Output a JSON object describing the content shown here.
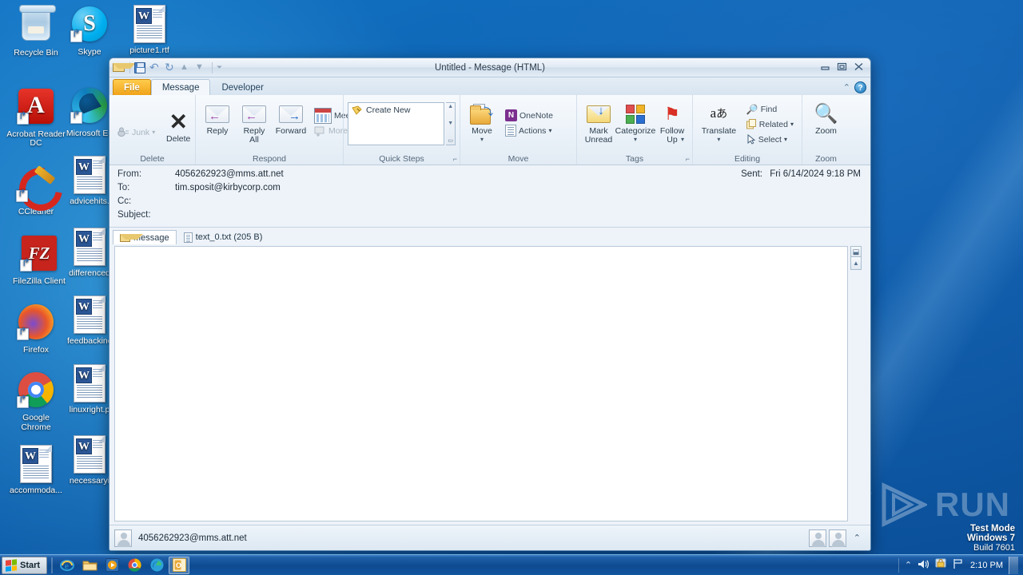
{
  "desktop": {
    "icons_col1": [
      {
        "name": "Recycle Bin",
        "kind": "recycle-bin"
      },
      {
        "name": "Acrobat Reader DC",
        "kind": "acrobat"
      },
      {
        "name": "CCleaner",
        "kind": "ccleaner"
      },
      {
        "name": "FileZilla Client",
        "kind": "filezilla"
      },
      {
        "name": "Firefox",
        "kind": "firefox"
      },
      {
        "name": "Google Chrome",
        "kind": "chrome"
      },
      {
        "name": "accommoda...",
        "kind": "word-doc"
      }
    ],
    "icons_col2": [
      {
        "name": "Skype",
        "kind": "skype"
      },
      {
        "name": "Microsoft Ed",
        "kind": "edge"
      },
      {
        "name": "advicehits.",
        "kind": "word-doc"
      },
      {
        "name": "differenced",
        "kind": "word-doc"
      },
      {
        "name": "feedbackinc",
        "kind": "word-doc"
      },
      {
        "name": "linuxright.p",
        "kind": "word-doc"
      },
      {
        "name": "necessaryi",
        "kind": "word-doc"
      }
    ],
    "icons_col3": [
      {
        "name": "picture1.rtf",
        "kind": "word-doc"
      }
    ]
  },
  "window": {
    "title": "Untitled  -  Message (HTML)",
    "quick_access": [
      {
        "name": "envelope-icon",
        "label": ""
      },
      {
        "name": "save-icon",
        "label": ""
      },
      {
        "name": "undo-icon",
        "label": "↰"
      },
      {
        "name": "redo-icon",
        "label": "↻"
      },
      {
        "name": "previous-item-icon",
        "label": "▲"
      },
      {
        "name": "next-item-icon",
        "label": "▼"
      },
      {
        "name": "customize-qat-icon",
        "label": "▼"
      }
    ],
    "controls": {
      "minimize": "—",
      "restore": "❐",
      "close": "✕"
    }
  },
  "tabs": {
    "file": "File",
    "items": [
      {
        "label": "Message",
        "active": true
      },
      {
        "label": "Developer",
        "active": false
      }
    ],
    "collapse_ribbon": "⌃",
    "help": "?"
  },
  "ribbon": {
    "groups": [
      {
        "label": "Delete",
        "small_buttons": [
          {
            "label": "Junk",
            "caret": "▾",
            "disabled": true
          }
        ],
        "big_buttons": [
          {
            "label": "Delete",
            "icon": "delete-x-icon"
          }
        ]
      },
      {
        "label": "Respond",
        "big_buttons": [
          {
            "label": "Reply",
            "icon": "reply-icon"
          },
          {
            "label": "Reply\nAll",
            "icon": "reply-all-icon"
          },
          {
            "label": "Forward",
            "icon": "forward-icon"
          }
        ],
        "small_buttons": [
          {
            "label": "Meeting",
            "icon": "meeting-icon",
            "disabled": false
          },
          {
            "label": "More",
            "caret": "▾",
            "icon": "more-icon",
            "disabled": true
          }
        ]
      },
      {
        "label": "Quick Steps",
        "gallery_item": "Create New",
        "has_dialog_launcher": true
      },
      {
        "label": "Move",
        "big_buttons": [
          {
            "label": "Move",
            "caret": "▾",
            "icon": "move-folder-icon"
          }
        ],
        "small_buttons": [
          {
            "label": "OneNote",
            "icon": "onenote-icon"
          },
          {
            "label": "Actions",
            "caret": "▾",
            "icon": "actions-icon"
          }
        ]
      },
      {
        "label": "Tags",
        "has_dialog_launcher": true,
        "big_buttons": [
          {
            "label": "Mark\nUnread",
            "icon": "mark-unread-icon"
          },
          {
            "label": "Categorize",
            "caret": "▾",
            "icon": "categorize-icon"
          },
          {
            "label": "Follow\nUp",
            "caret": "▾",
            "icon": "follow-up-flag-icon"
          }
        ]
      },
      {
        "label": "Editing",
        "big_buttons": [
          {
            "label": "Translate",
            "caret": "▾",
            "icon": "translate-icon"
          }
        ],
        "small_buttons": [
          {
            "label": "Find",
            "icon": "find-icon"
          },
          {
            "label": "Related",
            "caret": "▾",
            "icon": "related-icon"
          },
          {
            "label": "Select",
            "caret": "▾",
            "icon": "select-icon"
          }
        ]
      },
      {
        "label": "Zoom",
        "big_buttons": [
          {
            "label": "Zoom",
            "icon": "zoom-magnifier-icon"
          }
        ]
      }
    ]
  },
  "message": {
    "fields": [
      {
        "label": "From:",
        "value": "4056262923@mms.att.net"
      },
      {
        "label": "To:",
        "value": "tim.sposit@kirbycorp.com"
      },
      {
        "label": "Cc:",
        "value": ""
      },
      {
        "label": "Subject:",
        "value": ""
      }
    ],
    "sent_label": "Sent:",
    "sent_value": "Fri 6/14/2024 9:18 PM",
    "attachment_tabs": [
      {
        "label": "Message",
        "active": true,
        "icon": "envelope-icon"
      },
      {
        "label": "text_0.txt (205 B)",
        "active": false,
        "icon": "text-file-icon"
      }
    ],
    "body": ""
  },
  "status_bar": {
    "sender": "4056262923@mms.att.net",
    "expand_caret": "⌃"
  },
  "watermark": {
    "text_left": "A Y",
    "text_right": "RUN",
    "test_mode_line1": "Test Mode",
    "test_mode_line2": "Windows 7",
    "test_mode_line3": "Build 7601"
  },
  "taskbar": {
    "start_label": "Start",
    "pinned": [
      {
        "name": "internet-explorer-icon"
      },
      {
        "name": "windows-explorer-icon"
      },
      {
        "name": "windows-media-player-icon"
      },
      {
        "name": "google-chrome-icon"
      },
      {
        "name": "microsoft-edge-icon"
      },
      {
        "name": "outlook-icon",
        "active": true
      }
    ],
    "tray": [
      {
        "name": "show-hidden-icons",
        "glyph": "⌃"
      },
      {
        "name": "volume-icon",
        "glyph": "🔊"
      },
      {
        "name": "action-center-icon",
        "glyph": "⚑"
      },
      {
        "name": "network-icon",
        "glyph": "⚐"
      }
    ],
    "clock": "2:10 PM"
  },
  "colors": {
    "accent": "#f0a319",
    "desktop": "#0a6ab4",
    "ribbon_bg": "#eaf1f8"
  }
}
